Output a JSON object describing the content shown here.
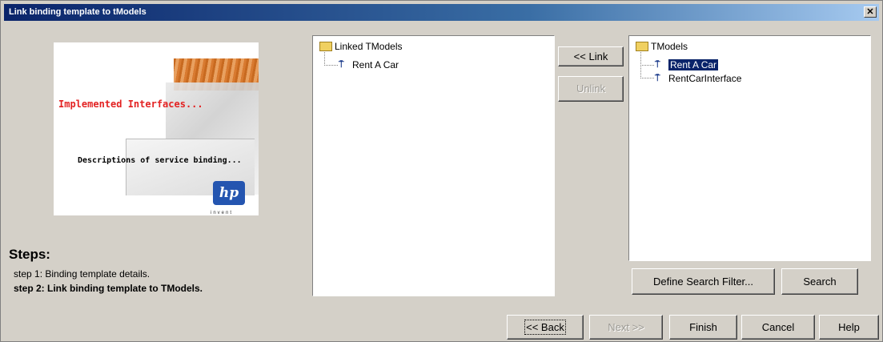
{
  "window": {
    "title": "Link binding template to tModels",
    "close_glyph": "✕"
  },
  "banner": {
    "heading": "Implemented Interfaces...",
    "description": "Descriptions of service binding...",
    "logo_text": "hp",
    "logo_subtext": "invent"
  },
  "steps": {
    "title": "Steps:",
    "items": [
      {
        "label": "step 1: Binding template details.",
        "current": false
      },
      {
        "label": "step 2: Link binding template to TModels.",
        "current": true
      }
    ]
  },
  "linked_tree": {
    "root_label": "Linked TModels",
    "children": [
      "Rent A Car"
    ]
  },
  "available_tree": {
    "root_label": "TModels",
    "children": [
      "Rent A Car",
      "RentCarInterface"
    ],
    "selected_child": "Rent A Car"
  },
  "actions": {
    "link_label": "<< Link",
    "unlink_label": "Unlink",
    "define_filter_label": "Define Search Filter...",
    "search_label": "Search"
  },
  "footer": {
    "back_label": "<< Back",
    "next_label": "Next >>",
    "finish_label": "Finish",
    "cancel_label": "Cancel",
    "help_label": "Help"
  },
  "colors": {
    "titlebar_start": "#0a246a",
    "dialog_bg": "#d4d0c8",
    "selection_bg": "#0a246a",
    "banner_heading": "#e32222"
  }
}
